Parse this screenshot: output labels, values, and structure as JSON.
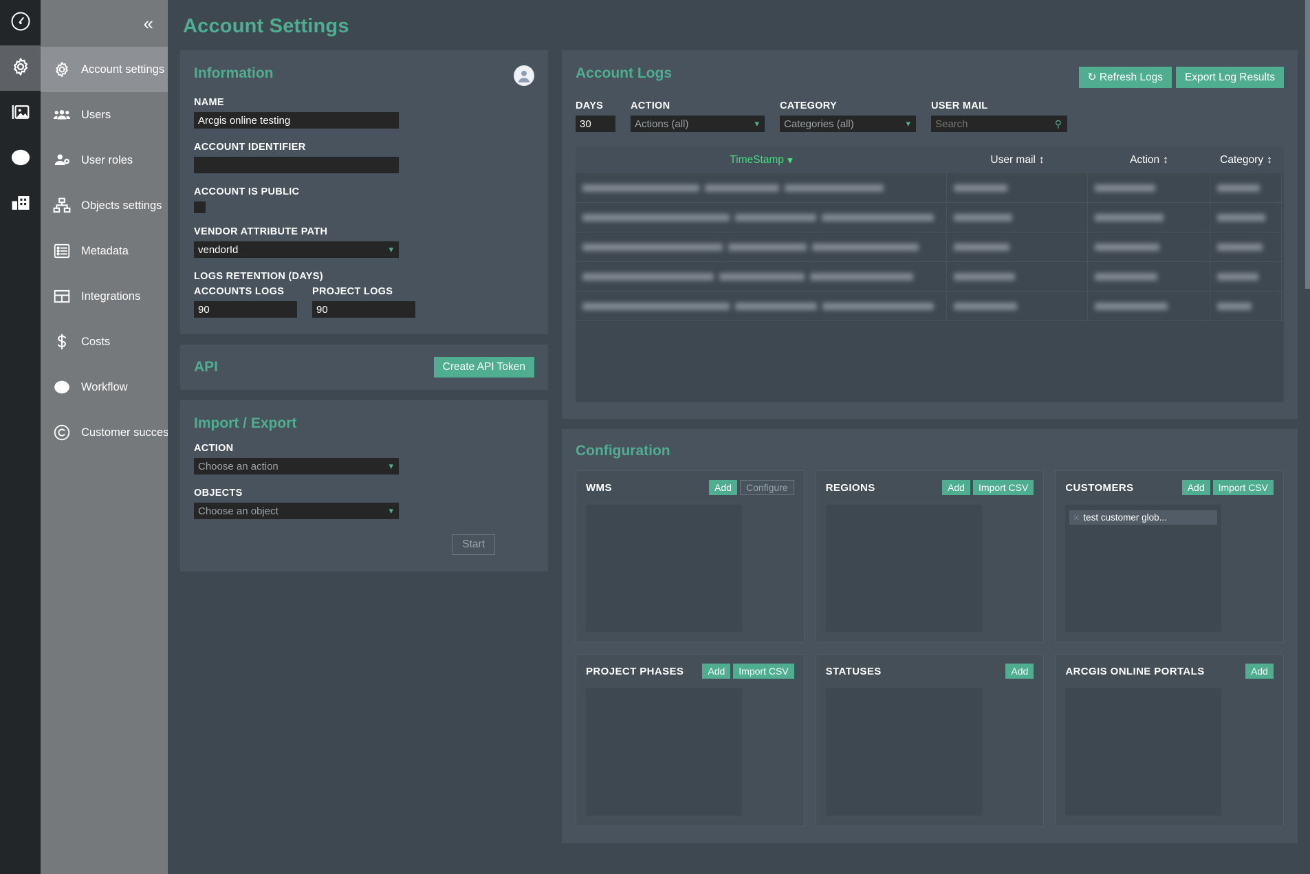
{
  "rail": {
    "items": [
      {
        "icon": "speedometer-icon",
        "active": false
      },
      {
        "icon": "gear-icon",
        "active": true
      },
      {
        "icon": "image-icon",
        "active": false
      },
      {
        "icon": "circle-icon",
        "active": false
      },
      {
        "icon": "building-icon",
        "active": false
      }
    ]
  },
  "sidebar": {
    "collapse_label": "«",
    "items": [
      {
        "label": "Account settings",
        "icon": "gear-icon",
        "active": true
      },
      {
        "label": "Users",
        "icon": "users-icon",
        "active": false
      },
      {
        "label": "User roles",
        "icon": "user-gear-icon",
        "active": false
      },
      {
        "label": "Objects settings",
        "icon": "sitemap-icon",
        "active": false
      },
      {
        "label": "Metadata",
        "icon": "list-icon",
        "active": false
      },
      {
        "label": "Integrations",
        "icon": "grid-icon",
        "active": false
      },
      {
        "label": "Costs",
        "icon": "dollar-icon",
        "active": false
      },
      {
        "label": "Workflow",
        "icon": "circle-icon",
        "active": false
      },
      {
        "label": "Customer success",
        "icon": "copyright-icon",
        "active": false
      }
    ]
  },
  "page": {
    "title": "Account Settings"
  },
  "information": {
    "title": "Information",
    "name_label": "NAME",
    "name_value": "Arcgis online testing",
    "account_identifier_label": "ACCOUNT IDENTIFIER",
    "account_identifier_value": "",
    "account_public_label": "ACCOUNT IS PUBLIC",
    "account_public_checked": false,
    "vendor_label": "VENDOR ATTRIBUTE PATH",
    "vendor_value": "vendorId",
    "retention_label": "LOGS RETENTION (DAYS)",
    "accounts_logs_label": "ACCOUNTS LOGS",
    "accounts_logs_value": "90",
    "project_logs_label": "PROJECT LOGS",
    "project_logs_value": "90"
  },
  "api": {
    "title": "API",
    "create_token_label": "Create API Token"
  },
  "import_export": {
    "title": "Import / Export",
    "action_label": "ACTION",
    "action_value": "Choose an action",
    "objects_label": "OBJECTS",
    "objects_value": "Choose an object",
    "start_label": "Start"
  },
  "account_logs": {
    "title": "Account Logs",
    "refresh_label": "Refresh Logs",
    "export_label": "Export Log Results",
    "days_label": "DAYS",
    "days_value": "30",
    "action_label": "ACTION",
    "action_value": "Actions (all)",
    "category_label": "CATEGORY",
    "category_value": "Categories (all)",
    "user_mail_label": "USER MAIL",
    "user_mail_placeholder": "Search",
    "columns": [
      {
        "label": "TimeStamp",
        "sorted": true,
        "sort_glyph": "▾"
      },
      {
        "label": "User mail",
        "sorted": false,
        "sort_glyph": "↕"
      },
      {
        "label": "Action",
        "sorted": false,
        "sort_glyph": "↕"
      },
      {
        "label": "Category",
        "sorted": false,
        "sort_glyph": "↕"
      }
    ],
    "rows": [
      {
        "timestamp": "",
        "user_mail": "",
        "action": "",
        "category": "",
        "w": [
          0.42,
          0.18,
          0.32,
          0.52,
          0.3
        ]
      },
      {
        "timestamp": "",
        "user_mail": "",
        "action": "",
        "category": "",
        "w": [
          0.6,
          0.22,
          0.4,
          0.62,
          0.26
        ]
      },
      {
        "timestamp": "",
        "user_mail": "",
        "action": "",
        "category": "",
        "w": [
          0.55,
          0.2,
          0.36,
          0.58,
          0.28
        ]
      },
      {
        "timestamp": "",
        "user_mail": "",
        "action": "",
        "category": "",
        "w": [
          0.5,
          0.24,
          0.34,
          0.5,
          0.24
        ]
      },
      {
        "timestamp": "",
        "user_mail": "",
        "action": "",
        "category": "",
        "w": [
          0.66,
          0.26,
          0.44,
          0.38,
          0.2
        ]
      }
    ]
  },
  "configuration": {
    "title": "Configuration",
    "cards": [
      {
        "title": "WMS",
        "buttons": [
          {
            "label": "Add",
            "style": "teal"
          },
          {
            "label": "Configure",
            "style": "ghost"
          }
        ],
        "entries": []
      },
      {
        "title": "REGIONS",
        "buttons": [
          {
            "label": "Add",
            "style": "teal"
          },
          {
            "label": "Import CSV",
            "style": "teal"
          }
        ],
        "entries": []
      },
      {
        "title": "CUSTOMERS",
        "buttons": [
          {
            "label": "Add",
            "style": "teal"
          },
          {
            "label": "Import CSV",
            "style": "teal"
          }
        ],
        "entries": [
          "test customer glob..."
        ]
      },
      {
        "title": "PROJECT PHASES",
        "buttons": [
          {
            "label": "Add",
            "style": "teal"
          },
          {
            "label": "Import CSV",
            "style": "teal"
          }
        ],
        "entries": []
      },
      {
        "title": "STATUSES",
        "buttons": [
          {
            "label": "Add",
            "style": "teal"
          }
        ],
        "entries": []
      },
      {
        "title": "ARCGIS ONLINE PORTALS",
        "buttons": [
          {
            "label": "Add",
            "style": "teal"
          }
        ],
        "entries": []
      }
    ]
  },
  "colors": {
    "accent": "#4fae8f",
    "sorted_header": "#3fe07e",
    "panel": "#48535d",
    "background": "#3e4851",
    "sidebar": "#76797c",
    "rail": "#222629",
    "input": "#262626"
  }
}
